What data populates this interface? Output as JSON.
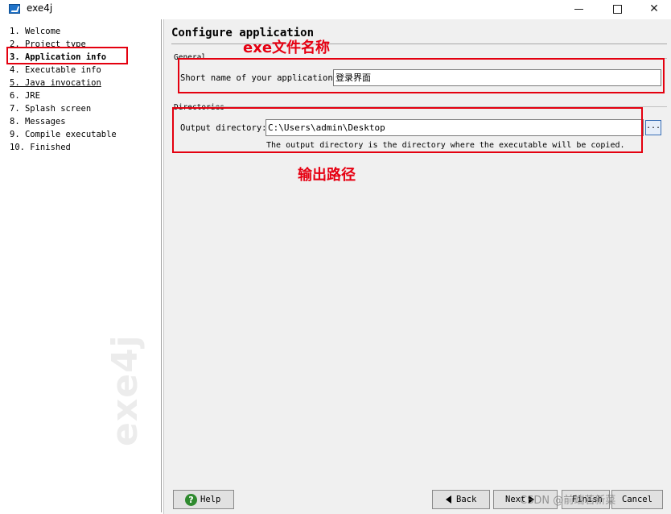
{
  "window": {
    "title": "exe4j",
    "icon": "exe4j-app-icon",
    "controls": [
      "minimize-icon",
      "maximize-icon",
      "close-icon"
    ]
  },
  "steps": [
    {
      "label": "1. Welcome"
    },
    {
      "label": "2. Project type"
    },
    {
      "label": "3. Application info",
      "active": true
    },
    {
      "label": "4. Executable info"
    },
    {
      "label": "5. Java invocation",
      "underlined": true
    },
    {
      "label": "6. JRE"
    },
    {
      "label": "7. Splash screen"
    },
    {
      "label": "8. Messages"
    },
    {
      "label": "9. Compile executable"
    },
    {
      "label": "10. Finished"
    }
  ],
  "sidebar_watermark": "exe4j",
  "panel": {
    "title": "Configure application",
    "general": {
      "section_label": "General",
      "short_name_label": "Short name of your application:",
      "short_name_value": "登录界面"
    },
    "directories": {
      "section_label": "Directories",
      "output_dir_label": "Output directory:",
      "output_dir_value": "C:\\Users\\admin\\Desktop",
      "browse_label": "...",
      "help_text": "The output directory is the directory where the executable will be copied."
    }
  },
  "annotations": {
    "name_note": "exe文件名称",
    "path_note": "输出路径",
    "color": "#e60012"
  },
  "buttons": {
    "help": "Help",
    "back": "Back",
    "next": "Next",
    "finish": "Finish",
    "cancel": "Cancel"
  },
  "overlay_watermark": "CSDN @前端若新菜"
}
